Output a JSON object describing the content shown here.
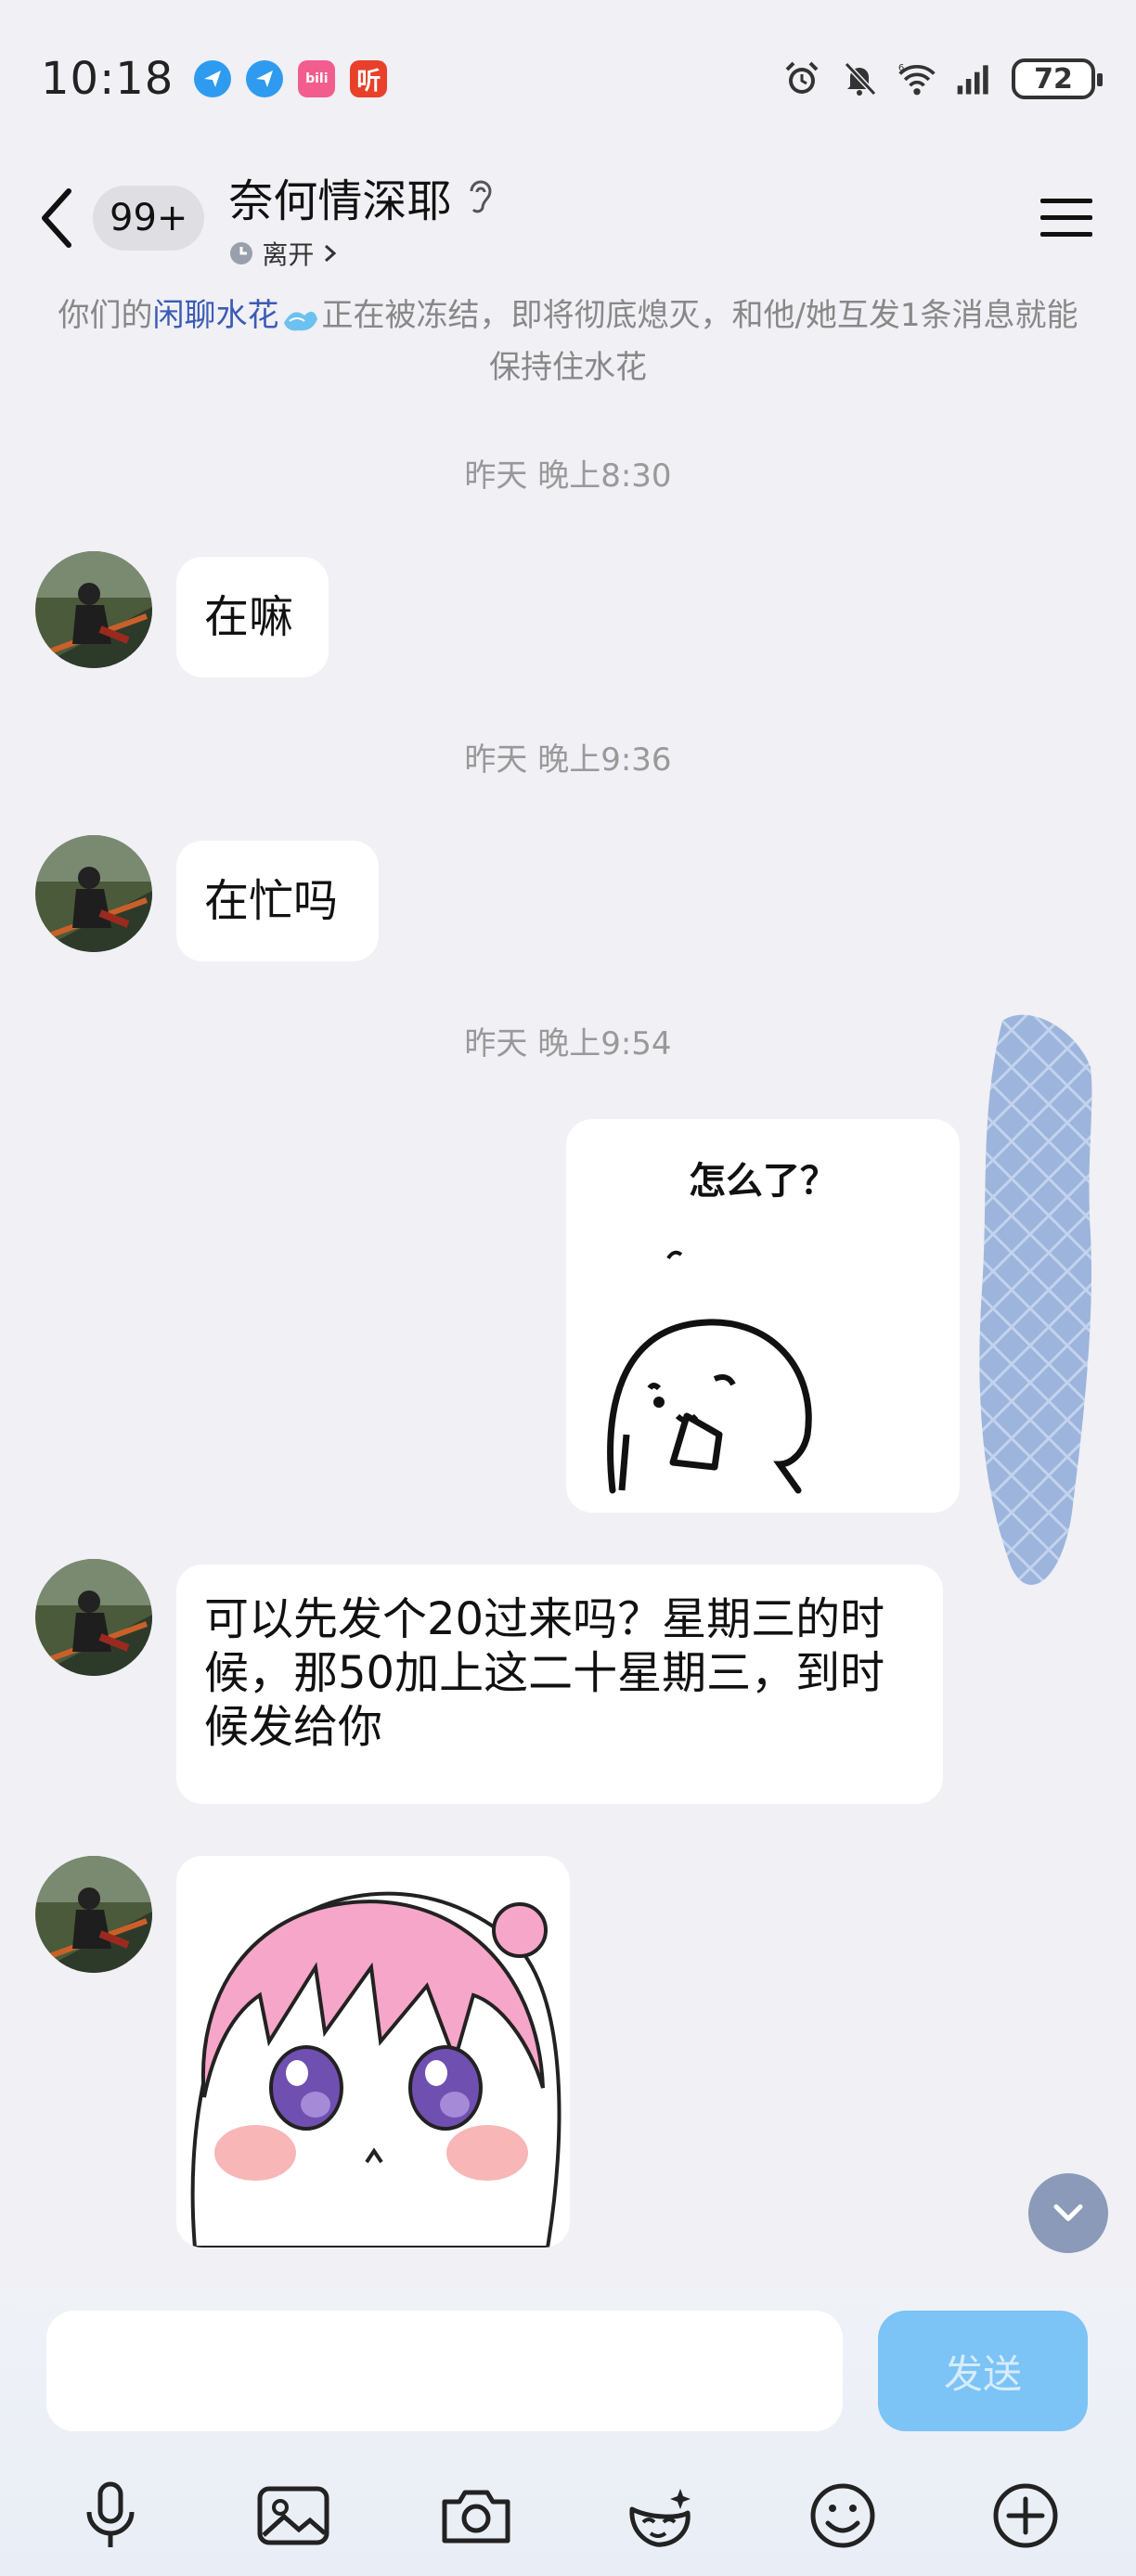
{
  "status_bar": {
    "time": "10:18",
    "app_icons": [
      {
        "name": "browser-icon",
        "color": "#2e9bf0",
        "glyph": "◈"
      },
      {
        "name": "browser-icon-2",
        "color": "#2e9bf0",
        "glyph": "◈"
      },
      {
        "name": "bilibili-icon",
        "color": "#f25d8e",
        "glyph": "bili"
      },
      {
        "name": "listen-app-icon",
        "color": "#e8402a",
        "glyph": "听"
      }
    ],
    "battery": "72"
  },
  "header": {
    "unread_count": "99+",
    "title": "奈何情深耶",
    "status": "离开"
  },
  "notice": {
    "prefix": "你们的",
    "highlight": "闲聊水花",
    "suffix": "正在被冻结，即将彻底熄灭，和他/她互发1条消息就能保持住水花"
  },
  "messages": {
    "ts1": "昨天 晚上8:30",
    "msg1": "在嘛",
    "ts2": "昨天 晚上9:36",
    "msg2": "在忙吗",
    "ts3": "昨天 晚上9:54",
    "sticker_caption": "怎么了？",
    "msg3": "可以先发个20过来吗？星期三的时候，那50加上这二十星期三，到时候发给你"
  },
  "input": {
    "placeholder": "",
    "send_label": "发送"
  },
  "colors": {
    "accent": "#3b5bb5",
    "send_button": "#7cc3f6",
    "background": "#f0f0f5"
  }
}
